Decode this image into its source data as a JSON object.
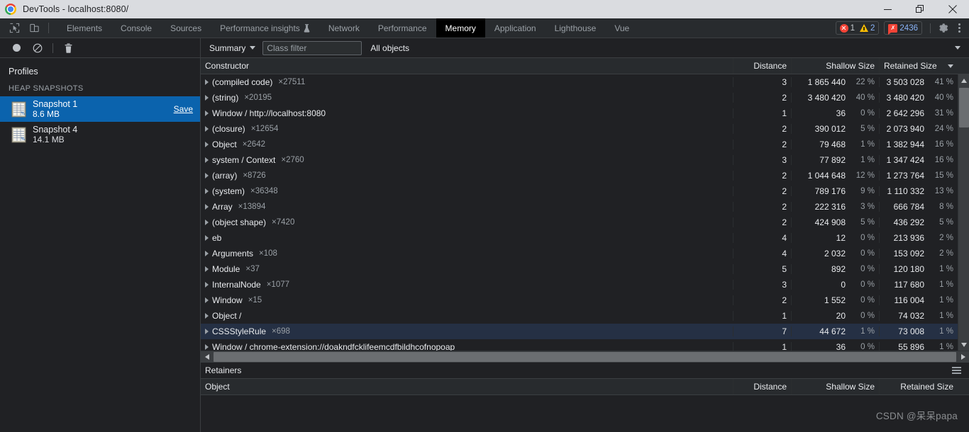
{
  "window": {
    "title": "DevTools - localhost:8080/",
    "minimize_label": "Minimize",
    "restore_label": "Restore",
    "close_label": "Close"
  },
  "devtools_tabbar": {
    "inspect_tooltip": "Inspect element",
    "device_tooltip": "Toggle device toolbar",
    "tabs": [
      {
        "label": "Elements",
        "active": false,
        "experimental": false
      },
      {
        "label": "Console",
        "active": false,
        "experimental": false
      },
      {
        "label": "Sources",
        "active": false,
        "experimental": false
      },
      {
        "label": "Performance insights",
        "active": false,
        "experimental": true
      },
      {
        "label": "Network",
        "active": false,
        "experimental": false
      },
      {
        "label": "Performance",
        "active": false,
        "experimental": false
      },
      {
        "label": "Memory",
        "active": true,
        "experimental": false
      },
      {
        "label": "Application",
        "active": false,
        "experimental": false
      },
      {
        "label": "Lighthouse",
        "active": false,
        "experimental": false
      },
      {
        "label": "Vue",
        "active": false,
        "experimental": false
      }
    ],
    "error_count": "1",
    "warning_count": "2",
    "issue_count": "2436",
    "issue_glyph": "✗",
    "settings_label": "Settings",
    "more_label": "More options"
  },
  "sidebar": {
    "toolbar": {
      "record_label": "Start recording heap snapshot",
      "clear_label": "Clear",
      "delete_label": "Delete profile"
    },
    "title": "Profiles",
    "group_label": "HEAP SNAPSHOTS",
    "snapshots": [
      {
        "name": "Snapshot 1",
        "size": "8.6 MB",
        "selected": true,
        "save_label": "Save"
      },
      {
        "name": "Snapshot 4",
        "size": "14.1 MB",
        "selected": false,
        "save_label": ""
      }
    ]
  },
  "main_toolbar": {
    "view_mode": "Summary",
    "class_filter_placeholder": "Class filter",
    "class_filter_value": "",
    "object_filter": "All objects"
  },
  "grid": {
    "columns": [
      {
        "key": "constructor",
        "label": "Constructor",
        "sorted": false
      },
      {
        "key": "distance",
        "label": "Distance",
        "sorted": false
      },
      {
        "key": "shallow",
        "label": "Shallow Size",
        "sorted": false
      },
      {
        "key": "retained",
        "label": "Retained Size",
        "sorted": true,
        "sort_dir": "desc"
      }
    ],
    "rows": [
      {
        "name": "(compiled code)",
        "count": "×27511",
        "distance": "3",
        "shallow": "1 865 440",
        "shallow_pct": "22 %",
        "retained": "3 503 028",
        "retained_pct": "41 %",
        "selected": false
      },
      {
        "name": "(string)",
        "count": "×20195",
        "distance": "2",
        "shallow": "3 480 420",
        "shallow_pct": "40 %",
        "retained": "3 480 420",
        "retained_pct": "40 %",
        "selected": false
      },
      {
        "name": "Window / http://localhost:8080",
        "count": "",
        "distance": "1",
        "shallow": "36",
        "shallow_pct": "0 %",
        "retained": "2 642 296",
        "retained_pct": "31 %",
        "selected": false
      },
      {
        "name": "(closure)",
        "count": "×12654",
        "distance": "2",
        "shallow": "390 012",
        "shallow_pct": "5 %",
        "retained": "2 073 940",
        "retained_pct": "24 %",
        "selected": false
      },
      {
        "name": "Object",
        "count": "×2642",
        "distance": "2",
        "shallow": "79 468",
        "shallow_pct": "1 %",
        "retained": "1 382 944",
        "retained_pct": "16 %",
        "selected": false
      },
      {
        "name": "system / Context",
        "count": "×2760",
        "distance": "3",
        "shallow": "77 892",
        "shallow_pct": "1 %",
        "retained": "1 347 424",
        "retained_pct": "16 %",
        "selected": false
      },
      {
        "name": "(array)",
        "count": "×8726",
        "distance": "2",
        "shallow": "1 044 648",
        "shallow_pct": "12 %",
        "retained": "1 273 764",
        "retained_pct": "15 %",
        "selected": false
      },
      {
        "name": "(system)",
        "count": "×36348",
        "distance": "2",
        "shallow": "789 176",
        "shallow_pct": "9 %",
        "retained": "1 110 332",
        "retained_pct": "13 %",
        "selected": false
      },
      {
        "name": "Array",
        "count": "×13894",
        "distance": "2",
        "shallow": "222 316",
        "shallow_pct": "3 %",
        "retained": "666 784",
        "retained_pct": "8 %",
        "selected": false
      },
      {
        "name": "(object shape)",
        "count": "×7420",
        "distance": "2",
        "shallow": "424 908",
        "shallow_pct": "5 %",
        "retained": "436 292",
        "retained_pct": "5 %",
        "selected": false
      },
      {
        "name": "eb",
        "count": "",
        "distance": "4",
        "shallow": "12",
        "shallow_pct": "0 %",
        "retained": "213 936",
        "retained_pct": "2 %",
        "selected": false
      },
      {
        "name": "Arguments",
        "count": "×108",
        "distance": "4",
        "shallow": "2 032",
        "shallow_pct": "0 %",
        "retained": "153 092",
        "retained_pct": "2 %",
        "selected": false
      },
      {
        "name": "Module",
        "count": "×37",
        "distance": "5",
        "shallow": "892",
        "shallow_pct": "0 %",
        "retained": "120 180",
        "retained_pct": "1 %",
        "selected": false
      },
      {
        "name": "InternalNode",
        "count": "×1077",
        "distance": "3",
        "shallow": "0",
        "shallow_pct": "0 %",
        "retained": "117 680",
        "retained_pct": "1 %",
        "selected": false
      },
      {
        "name": "Window",
        "count": "×15",
        "distance": "2",
        "shallow": "1 552",
        "shallow_pct": "0 %",
        "retained": "116 004",
        "retained_pct": "1 %",
        "selected": false
      },
      {
        "name": "Object /",
        "count": "",
        "distance": "1",
        "shallow": "20",
        "shallow_pct": "0 %",
        "retained": "74 032",
        "retained_pct": "1 %",
        "selected": false
      },
      {
        "name": "CSSStyleRule",
        "count": "×698",
        "distance": "7",
        "shallow": "44 672",
        "shallow_pct": "1 %",
        "retained": "73 008",
        "retained_pct": "1 %",
        "selected": true
      },
      {
        "name": "Window / chrome-extension://doakndfcklifeemcdfbildhcofnopoap",
        "count": "",
        "distance": "1",
        "shallow": "36",
        "shallow_pct": "0 %",
        "retained": "55 896",
        "retained_pct": "1 %",
        "selected": false
      }
    ]
  },
  "retainers": {
    "title": "Retainers",
    "menu_label": "More options",
    "columns": [
      {
        "key": "object",
        "label": "Object"
      },
      {
        "key": "distance",
        "label": "Distance"
      },
      {
        "key": "shallow",
        "label": "Shallow Size"
      },
      {
        "key": "retained",
        "label": "Retained Size"
      }
    ],
    "rows": []
  },
  "watermark": "CSDN @呆呆papa"
}
